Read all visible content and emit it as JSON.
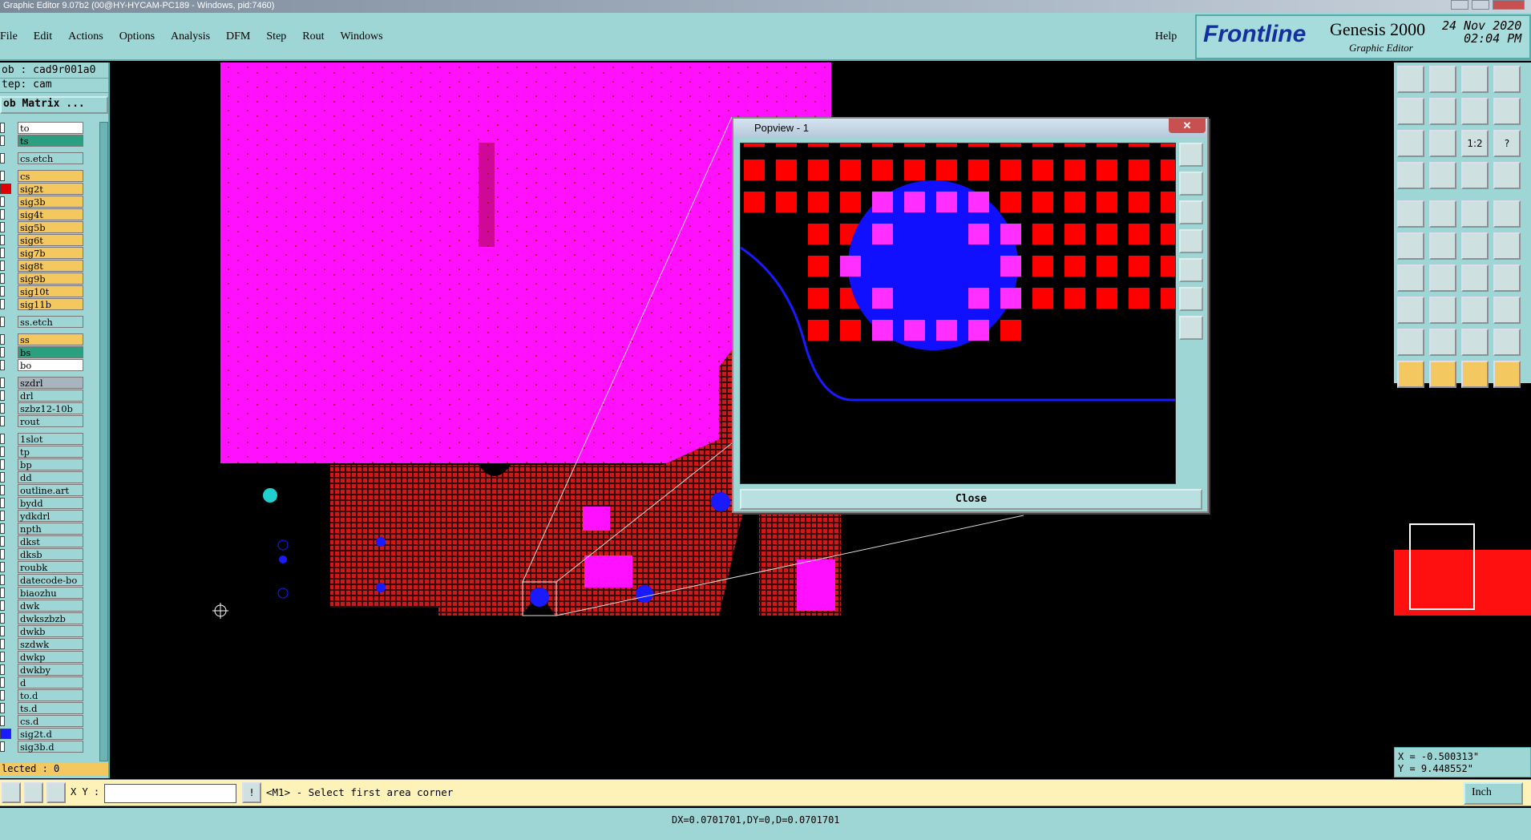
{
  "window": {
    "title": "Graphic Editor 9.07b2 (00@HY-HYCAM-PC189 - Windows, pid:7460)"
  },
  "menu": {
    "items": [
      "File",
      "Edit",
      "Actions",
      "Options",
      "Analysis",
      "DFM",
      "Step",
      "Rout",
      "Windows"
    ],
    "help": "Help"
  },
  "brand": {
    "logo": "Frontline",
    "product": "Genesis 2000",
    "subtitle": "Graphic Editor",
    "date": "24 Nov 2020",
    "time": "02:04 PM"
  },
  "job": {
    "job": "ob : cad9r001a0",
    "step": "tep: cam",
    "matrix": "ob Matrix ..."
  },
  "layers": [
    {
      "name": "to",
      "color": "#ffffff",
      "gap": false
    },
    {
      "name": "ts",
      "color": "#2aa080",
      "gap": false
    },
    {
      "name": "cs.etch",
      "color": "#9ed6d6",
      "gap": true
    },
    {
      "name": "cs",
      "color": "#f4c860",
      "gap": true
    },
    {
      "name": "sig2t",
      "color": "#f4c860",
      "gap": false,
      "mark": "#e00000"
    },
    {
      "name": "sig3b",
      "color": "#f4c860",
      "gap": false
    },
    {
      "name": "sig4t",
      "color": "#f4c860",
      "gap": false
    },
    {
      "name": "sig5b",
      "color": "#f4c860",
      "gap": false
    },
    {
      "name": "sig6t",
      "color": "#f4c860",
      "gap": false
    },
    {
      "name": "sig7b",
      "color": "#f4c860",
      "gap": false
    },
    {
      "name": "sig8t",
      "color": "#f4c860",
      "gap": false
    },
    {
      "name": "sig9b",
      "color": "#f4c860",
      "gap": false
    },
    {
      "name": "sig10t",
      "color": "#f4c860",
      "gap": false
    },
    {
      "name": "sig11b",
      "color": "#f4c860",
      "gap": false
    },
    {
      "name": "ss.etch",
      "color": "#9ed6d6",
      "gap": true
    },
    {
      "name": "ss",
      "color": "#f4c860",
      "gap": true
    },
    {
      "name": "bs",
      "color": "#2aa080",
      "gap": false
    },
    {
      "name": "bo",
      "color": "#ffffff",
      "gap": false
    },
    {
      "name": "szdrl",
      "color": "#a8b4c0",
      "gap": true
    },
    {
      "name": "drl",
      "color": "#9ed6d6",
      "gap": false
    },
    {
      "name": "szbz12-10b",
      "color": "#9ed6d6",
      "gap": false
    },
    {
      "name": "rout",
      "color": "#9ed6d6",
      "gap": false
    },
    {
      "name": "1slot",
      "color": "#9ed6d6",
      "gap": true
    },
    {
      "name": "tp",
      "color": "#9ed6d6",
      "gap": false
    },
    {
      "name": "bp",
      "color": "#9ed6d6",
      "gap": false
    },
    {
      "name": "dd",
      "color": "#9ed6d6",
      "gap": false
    },
    {
      "name": "outline.art",
      "color": "#9ed6d6",
      "gap": false
    },
    {
      "name": "bydd",
      "color": "#9ed6d6",
      "gap": false
    },
    {
      "name": "ydkdrl",
      "color": "#9ed6d6",
      "gap": false
    },
    {
      "name": "npth",
      "color": "#9ed6d6",
      "gap": false
    },
    {
      "name": "dkst",
      "color": "#9ed6d6",
      "gap": false
    },
    {
      "name": "dksb",
      "color": "#9ed6d6",
      "gap": false
    },
    {
      "name": "roubk",
      "color": "#9ed6d6",
      "gap": false
    },
    {
      "name": "datecode-bo",
      "color": "#9ed6d6",
      "gap": false
    },
    {
      "name": "biaozhu",
      "color": "#9ed6d6",
      "gap": false
    },
    {
      "name": "dwk",
      "color": "#9ed6d6",
      "gap": false
    },
    {
      "name": "dwkszbzb",
      "color": "#9ed6d6",
      "gap": false
    },
    {
      "name": "dwkb",
      "color": "#9ed6d6",
      "gap": false
    },
    {
      "name": "szdwk",
      "color": "#9ed6d6",
      "gap": false
    },
    {
      "name": "dwkp",
      "color": "#9ed6d6",
      "gap": false
    },
    {
      "name": "dwkby",
      "color": "#9ed6d6",
      "gap": false
    },
    {
      "name": "d",
      "color": "#9ed6d6",
      "gap": false
    },
    {
      "name": "to.d",
      "color": "#9ed6d6",
      "gap": false
    },
    {
      "name": "ts.d",
      "color": "#9ed6d6",
      "gap": false
    },
    {
      "name": "cs.d",
      "color": "#9ed6d6",
      "gap": false
    },
    {
      "name": "sig2t.d",
      "color": "#9ed6d6",
      "gap": false,
      "mark": "#1a1aff"
    },
    {
      "name": "sig3b.d",
      "color": "#9ed6d6",
      "gap": false
    }
  ],
  "selected": "lected : 0",
  "popview": {
    "title": "Popview - 1",
    "close": "Close"
  },
  "toolbar": {
    "ratio_label": "1:2",
    "help_label": "?"
  },
  "coords": {
    "x": "X = -0.500313\"",
    "y": "Y = 9.448552\""
  },
  "input": {
    "xy_label": "X Y :",
    "value": ""
  },
  "prompt": "<M1> - Select first area corner",
  "units": "Inch",
  "status": "DX=0.0701701,DY=0,D=0.0701701",
  "colors": {
    "board": "#ff10ff",
    "copper": "#e01010",
    "hole": "#1a1aff",
    "panel": "#9ed6d6",
    "active": "#f4c860"
  }
}
